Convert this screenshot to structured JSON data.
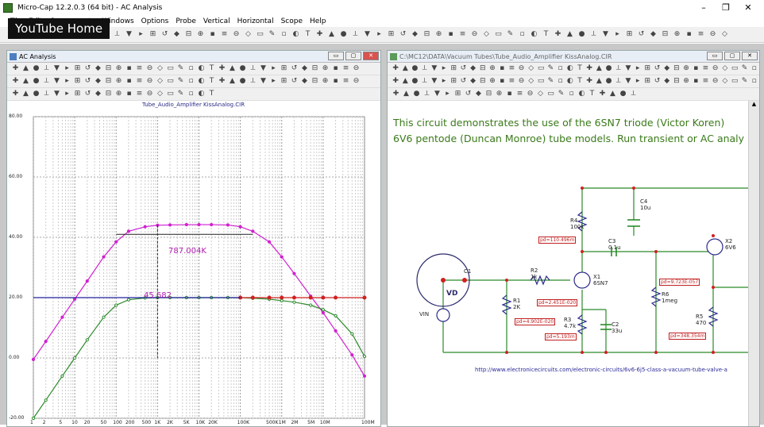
{
  "app": {
    "title": "Micro-Cap 12.2.0.3 (64 bit) - AC Analysis",
    "window_buttons": [
      "–",
      "❐",
      "✕"
    ]
  },
  "overlay": {
    "label": "YouTube Home"
  },
  "menu": [
    "File",
    "Edit",
    "Components",
    "Windows",
    "Options",
    "Probe",
    "Vertical",
    "Horizontal",
    "Scope",
    "Help"
  ],
  "ac_window": {
    "title": "AC Analysis",
    "plot_title": "Tube_Audio_Amplifier KissAnalog.CIR",
    "y_ticks": [
      "80.00",
      "60.00",
      "40.00",
      "20.00",
      "0.00",
      "-20.00"
    ],
    "x_ticks": [
      "1",
      "2",
      "5",
      "10",
      "20",
      "50",
      "100",
      "200",
      "500",
      "1K",
      "2K",
      "5K",
      "10K",
      "20K",
      "100K",
      "500K",
      "1M",
      "2M",
      "5M",
      "10M",
      "100M"
    ],
    "annotations": {
      "bandwidth": "787.004K",
      "gain": "45.682"
    }
  },
  "chart_data": {
    "type": "line",
    "xscale": "log",
    "xlim": [
      1,
      100000000
    ],
    "ylim": [
      -20,
      80
    ],
    "series": [
      {
        "color": "#d020d0",
        "x": [
          1,
          2,
          5,
          10,
          20,
          50,
          100,
          200,
          500,
          1000,
          2000,
          5000,
          10000,
          20000,
          50000,
          100000,
          200000,
          500000,
          1000000,
          2000000,
          5000000,
          10000000,
          20000000,
          50000000,
          100000000
        ],
        "y": [
          -0.5,
          5.5,
          13.5,
          19.5,
          25.5,
          33.5,
          38.5,
          42,
          43.5,
          44,
          44.1,
          44.2,
          44.2,
          44.2,
          44.1,
          43.5,
          42,
          38.5,
          33.5,
          28,
          20.5,
          15,
          9,
          1,
          -6
        ]
      },
      {
        "color": "#2a8a2a",
        "x": [
          1,
          2,
          5,
          10,
          20,
          50,
          100,
          200,
          500,
          1000,
          2000,
          5000,
          10000,
          20000,
          50000,
          100000,
          200000,
          500000,
          1000000,
          2000000,
          5000000,
          10000000,
          20000000,
          50000000,
          100000000
        ],
        "y": [
          -20,
          -14,
          -6,
          0,
          6,
          13.5,
          17.5,
          19.3,
          19.9,
          20,
          20,
          20,
          20,
          20,
          20,
          20,
          19.8,
          19.5,
          19,
          18.5,
          17.5,
          16,
          14,
          8,
          0.5
        ]
      },
      {
        "color": "#d02020",
        "x": [
          100000,
          200000,
          500000,
          1000000,
          2000000,
          5000000,
          10000000,
          20000000,
          100000000
        ],
        "y": [
          20,
          20,
          20,
          20,
          20,
          20,
          20,
          20,
          20
        ]
      },
      {
        "color": "#2020a0",
        "x": [
          1,
          100000
        ],
        "y": [
          20,
          20
        ]
      }
    ]
  },
  "schematic_window": {
    "title": "C:\\MC12\\DATA\\Vacuum Tubes\\Tube_Audio_Amplifier KissAnalog.CIR",
    "description_line1": "This circuit demonstrates the use of the 6SN7 triode (Victor Koren)",
    "description_line2": "6V6 pentode (Duncan Monroe) tube models. Run transient or AC analy",
    "link": "http://www.electronicecircuits.com/electronic-circuits/6v6-6j5-class-a-vacuum-tube-valve-a",
    "components": [
      {
        "ref": "R4",
        "value": "100k"
      },
      {
        "ref": "C4",
        "value": "10u"
      },
      {
        "ref": "C3",
        "value": "0.1u"
      },
      {
        "ref": "R2",
        "value": "1k"
      },
      {
        "ref": "X1",
        "value": "6SN7"
      },
      {
        "ref": "R1",
        "value": "2K"
      },
      {
        "ref": "R3",
        "value": "4.7k"
      },
      {
        "ref": "C2",
        "value": "33u"
      },
      {
        "ref": "R6",
        "value": "1meg"
      },
      {
        "ref": "R5",
        "value": "470"
      },
      {
        "ref": "X2",
        "value": "6V6"
      },
      {
        "ref": "VIN",
        "value": ""
      },
      {
        "ref": "C1",
        "value": ""
      }
    ],
    "power_labels": [
      {
        "text": "pd=110.496m"
      },
      {
        "text": "pd=2.451E-020"
      },
      {
        "text": "pd=4.902E-020"
      },
      {
        "text": "pd=5.193m"
      },
      {
        "text": "pd=9.723E-057"
      },
      {
        "text": "pd=348.354m"
      }
    ],
    "probe_label": "VD"
  }
}
